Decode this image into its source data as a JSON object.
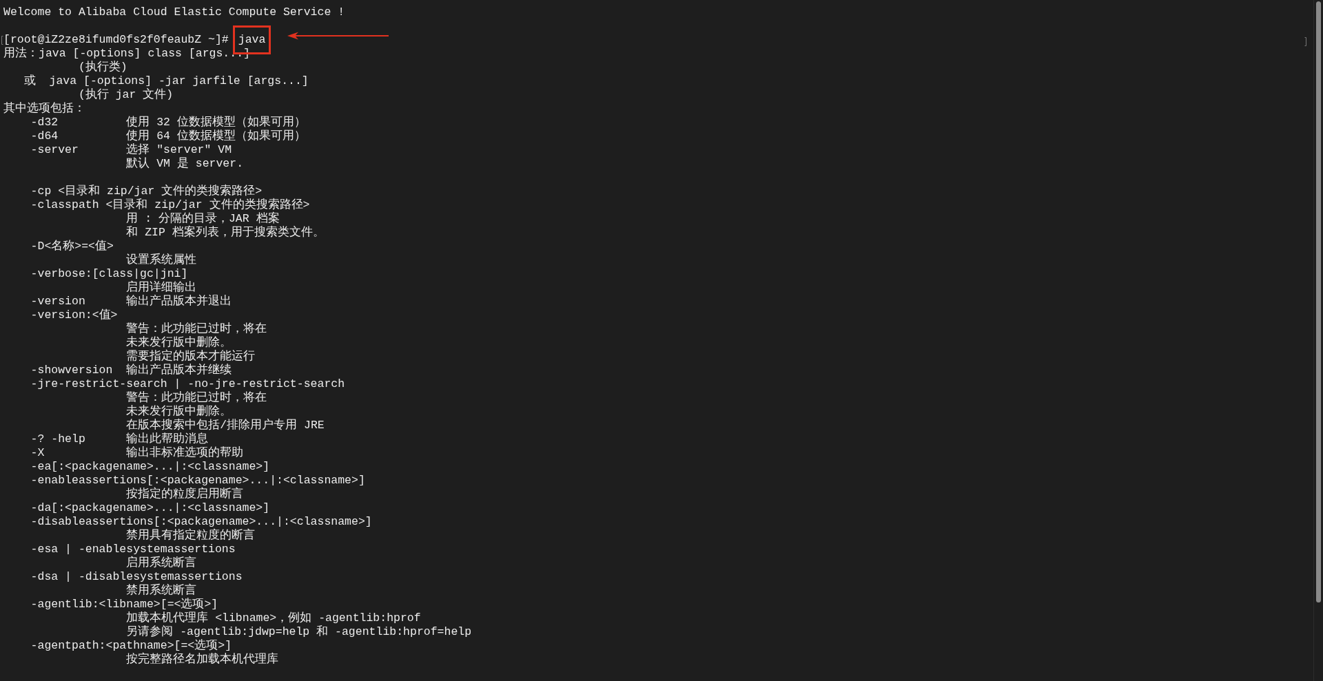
{
  "terminal": {
    "lines": [
      {
        "kind": "text",
        "text": "Welcome to Alibaba Cloud Elastic Compute Service !"
      },
      {
        "kind": "blank"
      },
      {
        "kind": "prompt",
        "prompt": "[root@iZ2ze8ifumd0fs2f0feaubZ ~]#",
        "command": "java"
      },
      {
        "kind": "text",
        "text": "用法：java [-options] class [args...]"
      },
      {
        "kind": "text",
        "text": "           (执行类)"
      },
      {
        "kind": "text",
        "text": "   或  java [-options] -jar jarfile [args...]"
      },
      {
        "kind": "text",
        "text": "           (执行 jar 文件)"
      },
      {
        "kind": "text",
        "text": "其中选项包括："
      },
      {
        "kind": "text",
        "text": "    -d32          使用 32 位数据模型（如果可用）"
      },
      {
        "kind": "text",
        "text": "    -d64          使用 64 位数据模型（如果可用）"
      },
      {
        "kind": "text",
        "text": "    -server       选择 \"server\" VM"
      },
      {
        "kind": "text",
        "text": "                  默认 VM 是 server."
      },
      {
        "kind": "blank"
      },
      {
        "kind": "text",
        "text": "    -cp <目录和 zip/jar 文件的类搜索路径>"
      },
      {
        "kind": "text",
        "text": "    -classpath <目录和 zip/jar 文件的类搜索路径>"
      },
      {
        "kind": "text",
        "text": "                  用 : 分隔的目录，JAR 档案"
      },
      {
        "kind": "text",
        "text": "                  和 ZIP 档案列表，用于搜索类文件。"
      },
      {
        "kind": "text",
        "text": "    -D<名称>=<值>"
      },
      {
        "kind": "text",
        "text": "                  设置系统属性"
      },
      {
        "kind": "text",
        "text": "    -verbose:[class|gc|jni]"
      },
      {
        "kind": "text",
        "text": "                  启用详细输出"
      },
      {
        "kind": "text",
        "text": "    -version      输出产品版本并退出"
      },
      {
        "kind": "text",
        "text": "    -version:<值>"
      },
      {
        "kind": "text",
        "text": "                  警告：此功能已过时，将在"
      },
      {
        "kind": "text",
        "text": "                  未来发行版中删除。"
      },
      {
        "kind": "text",
        "text": "                  需要指定的版本才能运行"
      },
      {
        "kind": "text",
        "text": "    -showversion  输出产品版本并继续"
      },
      {
        "kind": "text",
        "text": "    -jre-restrict-search | -no-jre-restrict-search"
      },
      {
        "kind": "text",
        "text": "                  警告：此功能已过时，将在"
      },
      {
        "kind": "text",
        "text": "                  未来发行版中删除。"
      },
      {
        "kind": "text",
        "text": "                  在版本搜索中包括/排除用户专用 JRE"
      },
      {
        "kind": "text",
        "text": "    -? -help      输出此帮助消息"
      },
      {
        "kind": "text",
        "text": "    -X            输出非标准选项的帮助"
      },
      {
        "kind": "text",
        "text": "    -ea[:<packagename>...|:<classname>]"
      },
      {
        "kind": "text",
        "text": "    -enableassertions[:<packagename>...|:<classname>]"
      },
      {
        "kind": "text",
        "text": "                  按指定的粒度启用断言"
      },
      {
        "kind": "text",
        "text": "    -da[:<packagename>...|:<classname>]"
      },
      {
        "kind": "text",
        "text": "    -disableassertions[:<packagename>...|:<classname>]"
      },
      {
        "kind": "text",
        "text": "                  禁用具有指定粒度的断言"
      },
      {
        "kind": "text",
        "text": "    -esa | -enablesystemassertions"
      },
      {
        "kind": "text",
        "text": "                  启用系统断言"
      },
      {
        "kind": "text",
        "text": "    -dsa | -disablesystemassertions"
      },
      {
        "kind": "text",
        "text": "                  禁用系统断言"
      },
      {
        "kind": "text",
        "text": "    -agentlib:<libname>[=<选项>]"
      },
      {
        "kind": "text",
        "text": "                  加载本机代理库 <libname>，例如 -agentlib:hprof"
      },
      {
        "kind": "text",
        "text": "                  另请参阅 -agentlib:jdwp=help 和 -agentlib:hprof=help"
      },
      {
        "kind": "text",
        "text": "    -agentpath:<pathname>[=<选项>]"
      },
      {
        "kind": "text",
        "text": "                  按完整路径名加载本机代理库"
      }
    ]
  }
}
